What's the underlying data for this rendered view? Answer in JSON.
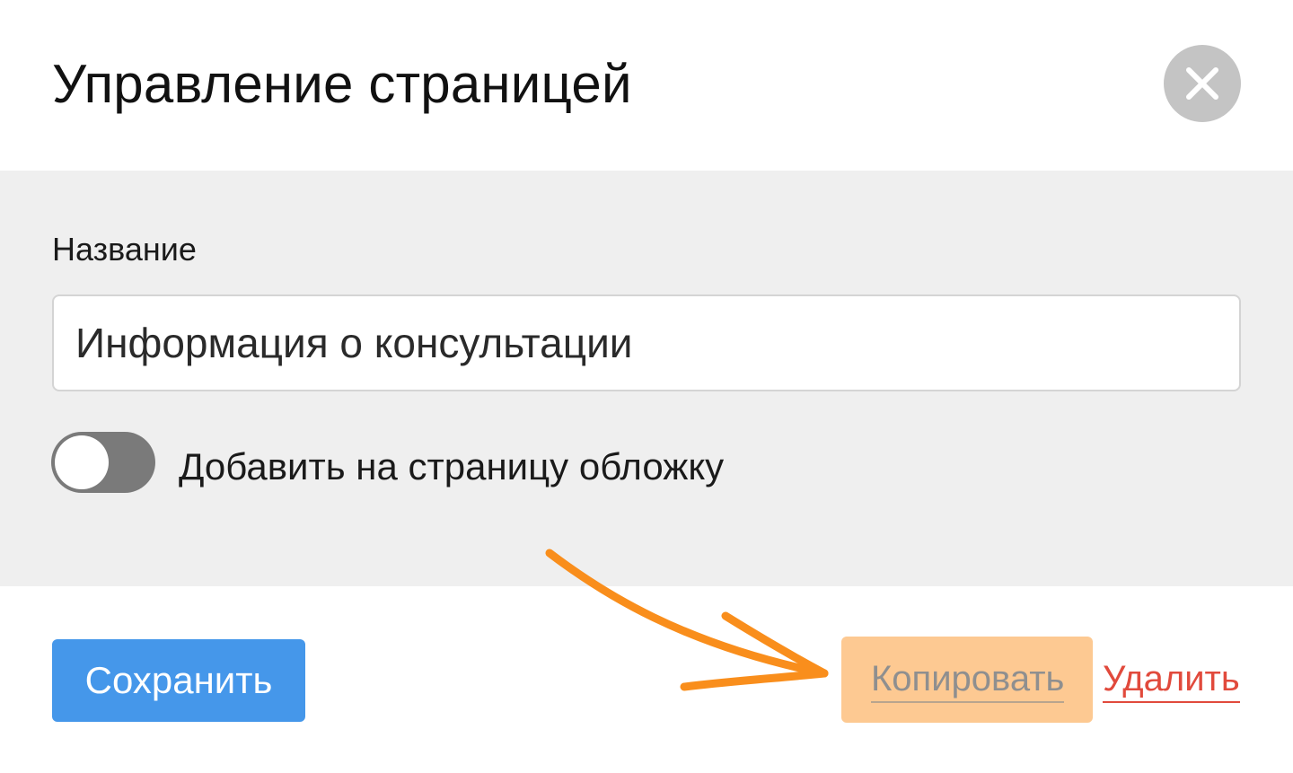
{
  "dialog": {
    "title": "Управление страницей",
    "close_icon": "close-icon"
  },
  "form": {
    "name_label": "Название",
    "name_value": "Информация о консультации",
    "cover_toggle": {
      "label": "Добавить на страницу обложку",
      "enabled": false
    }
  },
  "actions": {
    "save_label": "Сохранить",
    "copy_label": "Копировать",
    "delete_label": "Удалить"
  },
  "annotation": {
    "arrow_icon": "arrow-icon",
    "arrow_color": "#f98e1c",
    "highlight_color": "#fdc992"
  },
  "colors": {
    "primary": "#4597ea",
    "danger": "#e14a3c",
    "panel": "#efefef",
    "toggle_off": "#7a7a7a",
    "close_bg": "#c4c4c4"
  }
}
